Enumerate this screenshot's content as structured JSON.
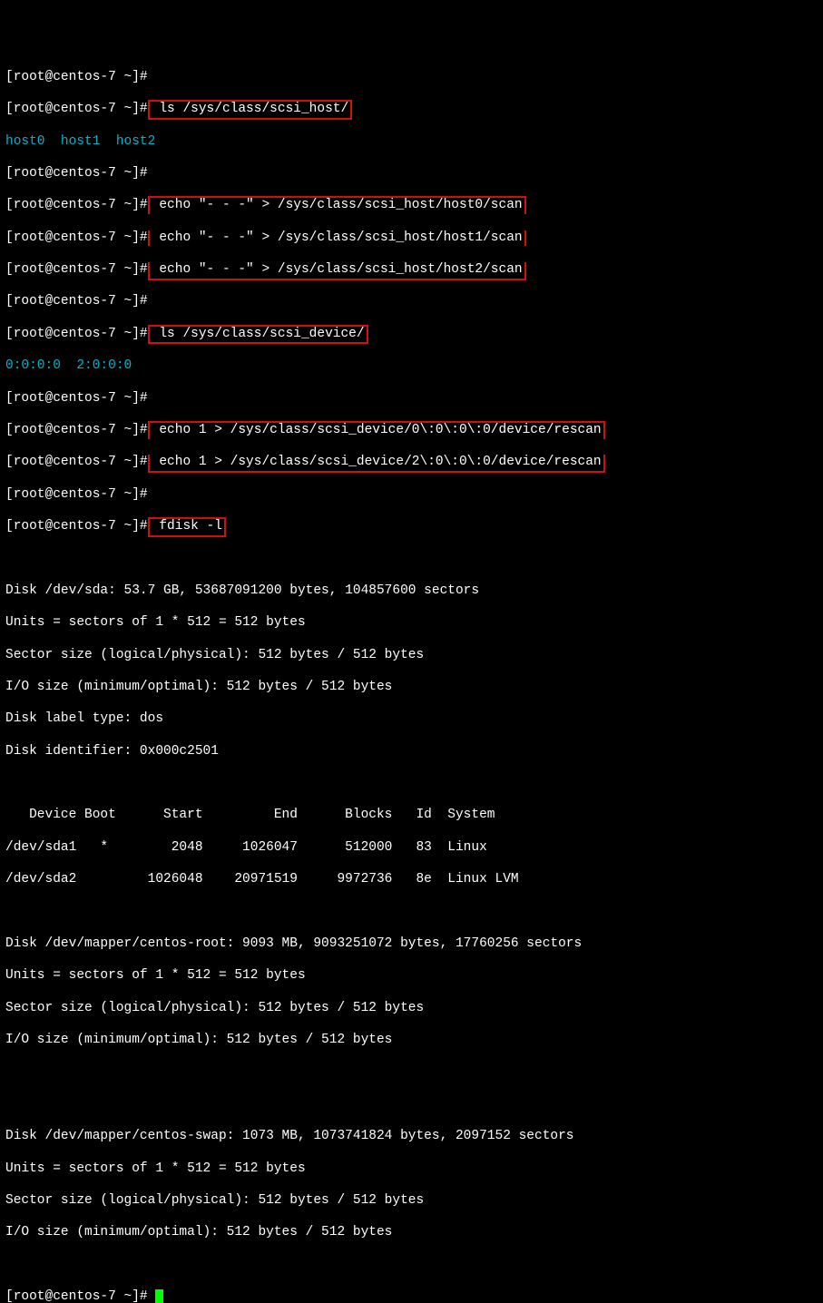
{
  "prompt": "[root@centos-7 ~]#",
  "cmd1": " ls /sys/class/scsi_host/",
  "hosts": "host0  host1  host2",
  "cmd2a": " echo \"- - -\" > /sys/class/scsi_host/host0/scan",
  "cmd2b": " echo \"- - -\" > /sys/class/scsi_host/host1/scan",
  "cmd2c": " echo \"- - -\" > /sys/class/scsi_host/host2/scan",
  "cmd3": " ls /sys/class/scsi_device/",
  "devices": "0:0:0:0  2:0:0:0",
  "cmd4a": " echo 1 > /sys/class/scsi_device/0\\:0\\:0\\:0/device/rescan",
  "cmd4b": " echo 1 > /sys/class/scsi_device/2\\:0\\:0\\:0/device/rescan",
  "cmd5": " fdisk -l",
  "out": {
    "l1": "Disk /dev/sda: 53.7 GB, 53687091200 bytes, 104857600 sectors",
    "l2": "Units = sectors of 1 * 512 = 512 bytes",
    "l3": "Sector size (logical/physical): 512 bytes / 512 bytes",
    "l4": "I/O size (minimum/optimal): 512 bytes / 512 bytes",
    "l5": "Disk label type: dos",
    "l6": "Disk identifier: 0x000c2501",
    "h1": "   Device Boot      Start         End      Blocks   Id  System",
    "r1": "/dev/sda1   *        2048     1026047      512000   83  Linux",
    "r2": "/dev/sda2         1026048    20971519     9972736   8e  Linux LVM",
    "m1": "Disk /dev/mapper/centos-root: 9093 MB, 9093251072 bytes, 17760256 sectors",
    "m2": "Units = sectors of 1 * 512 = 512 bytes",
    "m3": "Sector size (logical/physical): 512 bytes / 512 bytes",
    "m4": "I/O size (minimum/optimal): 512 bytes / 512 bytes",
    "s1": "Disk /dev/mapper/centos-swap: 1073 MB, 1073741824 bytes, 2097152 sectors",
    "s2": "Units = sectors of 1 * 512 = 512 bytes",
    "s3": "Sector size (logical/physical): 512 bytes / 512 bytes",
    "s4": "I/O size (minimum/optimal): 512 bytes / 512 bytes"
  }
}
